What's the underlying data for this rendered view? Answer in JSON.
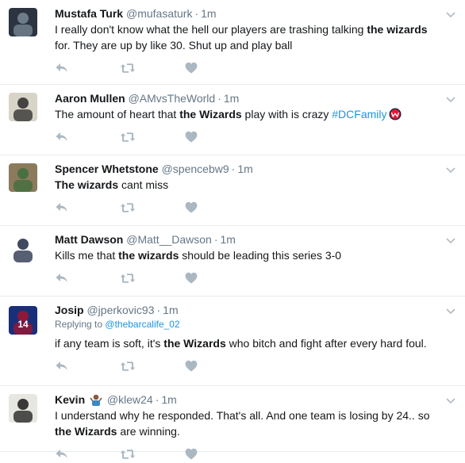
{
  "tweets": [
    {
      "name": "Mustafa Turk",
      "handle": "@mufasaturk",
      "sep": "·",
      "time": "1m",
      "text": [
        {
          "t": "I really don't know what the hell our players are trashing talking "
        },
        {
          "t": "the wizards",
          "b": true
        },
        {
          "t": " for. They are up by like 30. Shut up and play ball"
        }
      ],
      "avatar": "avatar-photo-couple",
      "avatar_colors": [
        "#2b3440",
        "#7a8a96"
      ]
    },
    {
      "name": "Aaron Mullen",
      "handle": "@AMvsTheWorld",
      "sep": "·",
      "time": "1m",
      "text": [
        {
          "t": "The amount of heart that "
        },
        {
          "t": "the Wizards",
          "b": true
        },
        {
          "t": " play with is crazy "
        },
        {
          "t": "#DCFamily",
          "tag": true
        }
      ],
      "badge": "wizards-logo-icon",
      "avatar": "avatar-photo-man",
      "avatar_colors": [
        "#d9d4c8",
        "#2a2a2a"
      ]
    },
    {
      "name": "Spencer Whetstone",
      "handle": "@spencebw9",
      "sep": "·",
      "time": "1m",
      "text": [
        {
          "t": "The wizards",
          "b": true
        },
        {
          "t": " cant miss"
        }
      ],
      "avatar": "avatar-photo-building",
      "avatar_colors": [
        "#8c7a5c",
        "#3d6e3b"
      ]
    },
    {
      "name": "Matt Dawson",
      "handle": "@Matt__Dawson",
      "sep": "·",
      "time": "1m",
      "text": [
        {
          "t": "Kills me that "
        },
        {
          "t": "the wizards",
          "b": true
        },
        {
          "t": " should be leading this series 3-0"
        }
      ],
      "avatar": "avatar-photo-suit",
      "avatar_colors": [
        "#ffffff",
        "#1f2a44"
      ]
    },
    {
      "name": "Josip",
      "handle": "@jperkovic93",
      "sep": "·",
      "time": "1m",
      "reply_label": "Replying to",
      "reply_handle": "@thebarcalife_02",
      "text": [
        {
          "t": "if any team is soft, it's "
        },
        {
          "t": "the Wizards",
          "b": true
        },
        {
          "t": " who bitch and fight after every hard foul."
        }
      ],
      "avatar": "avatar-photo-jersey",
      "avatar_colors": [
        "#1a2f7a",
        "#a3142d"
      ],
      "avatar_text": "14"
    },
    {
      "name": "Kevin",
      "handle": "@klew24",
      "sep": "·",
      "time": "1m",
      "text": [
        {
          "t": "I understand why he responded. That's all. And one team is losing by 24.. so "
        },
        {
          "t": "the Wizards",
          "b": true
        },
        {
          "t": " are winning."
        }
      ],
      "emoji": "person-shrugging-emoji",
      "avatar": "avatar-photo-player",
      "avatar_colors": [
        "#e8e6e0",
        "#1a1a1a"
      ]
    }
  ],
  "colors": {
    "text": "#14171a",
    "muted": "#657786",
    "link": "#1b95e0",
    "icon": "#aab8c2",
    "divider": "#e6ecf0"
  }
}
